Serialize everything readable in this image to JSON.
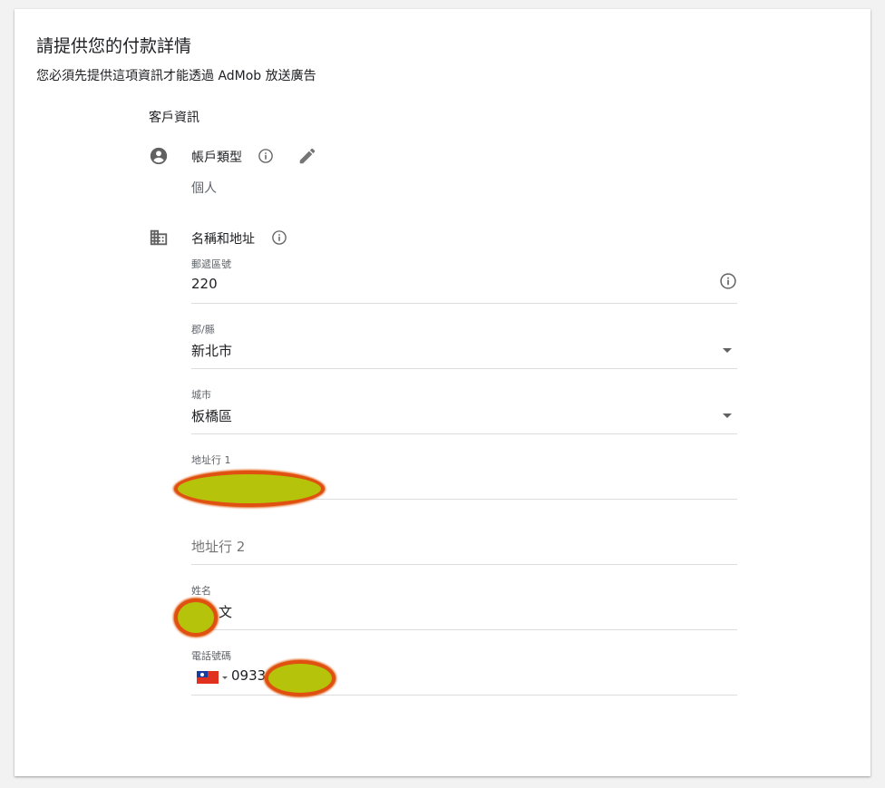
{
  "header": {
    "title": "請提供您的付款詳情",
    "subtitle": "您必須先提供這項資訊才能透過 AdMob 放送廣告"
  },
  "customer_info": {
    "section_title": "客戶資訊",
    "account_type": {
      "label": "帳戶類型",
      "value": "個人",
      "icon": "account-circle-icon"
    },
    "name_address": {
      "label": "名稱和地址",
      "icon": "building-icon"
    }
  },
  "form": {
    "postal_code": {
      "label": "郵遞區號",
      "value": "220"
    },
    "county": {
      "label": "郡/縣",
      "value": "新北市"
    },
    "city": {
      "label": "城市",
      "value": "板橋區"
    },
    "address_line1": {
      "label": "地址行 1",
      "value": ""
    },
    "address_line2": {
      "placeholder": "地址行 2"
    },
    "name": {
      "label": "姓名",
      "value": "文"
    },
    "phone": {
      "label": "電話號碼",
      "value": "0933",
      "country_flag": "taiwan-flag-icon"
    }
  },
  "colors": {
    "text_primary": "#202124",
    "text_secondary": "#5f6368",
    "icon_gray": "#616161",
    "divider": "#dadce0",
    "redaction_fill": "#b5c40a",
    "redaction_outline": "#e05010"
  }
}
